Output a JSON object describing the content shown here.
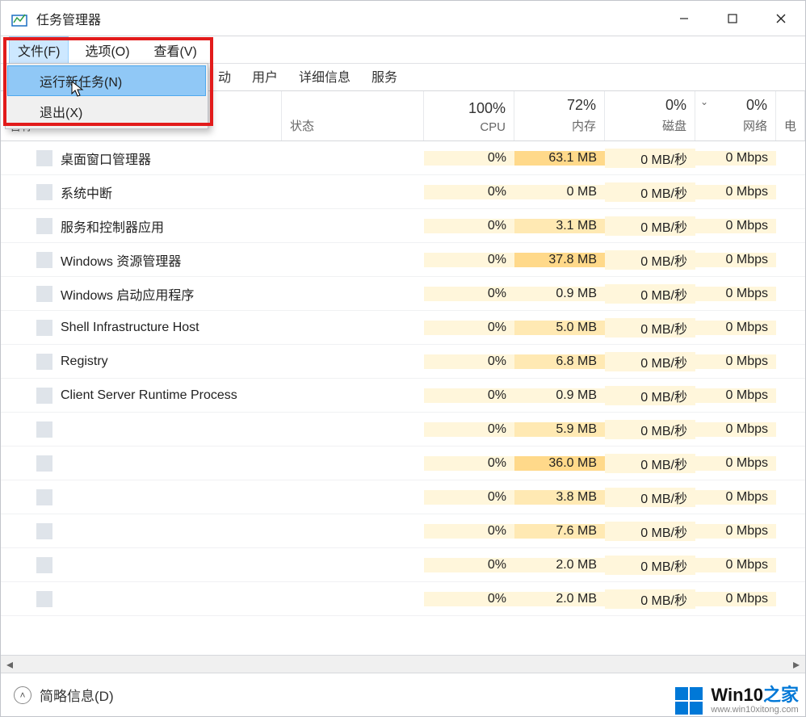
{
  "window": {
    "title": "任务管理器"
  },
  "menubar": {
    "file": "文件(F)",
    "options": "选项(O)",
    "view": "查看(V)"
  },
  "file_menu": {
    "run_new_task": "运行新任务(N)",
    "exit": "退出(X)"
  },
  "tabs": {
    "startup_suffix": "动",
    "users": "用户",
    "details": "详细信息",
    "services": "服务"
  },
  "columns": {
    "name": "名称",
    "status": "状态",
    "cpu_pct": "100%",
    "cpu_label": "CPU",
    "mem_pct": "72%",
    "mem_label": "内存",
    "disk_pct": "0%",
    "disk_label": "磁盘",
    "net_pct": "0%",
    "net_label": "网络",
    "power_label": "电"
  },
  "processes": [
    {
      "name": "桌面窗口管理器",
      "cpu": "0%",
      "mem": "63.1 MB",
      "mem_lvl": "high",
      "disk": "0 MB/秒",
      "net": "0 Mbps"
    },
    {
      "name": "系统中断",
      "cpu": "0%",
      "mem": "0 MB",
      "mem_lvl": "low",
      "disk": "0 MB/秒",
      "net": "0 Mbps"
    },
    {
      "name": "服务和控制器应用",
      "cpu": "0%",
      "mem": "3.1 MB",
      "mem_lvl": "mid",
      "disk": "0 MB/秒",
      "net": "0 Mbps"
    },
    {
      "name": "Windows 资源管理器",
      "cpu": "0%",
      "mem": "37.8 MB",
      "mem_lvl": "high",
      "disk": "0 MB/秒",
      "net": "0 Mbps"
    },
    {
      "name": "Windows 启动应用程序",
      "cpu": "0%",
      "mem": "0.9 MB",
      "mem_lvl": "low",
      "disk": "0 MB/秒",
      "net": "0 Mbps"
    },
    {
      "name": "Shell Infrastructure Host",
      "cpu": "0%",
      "mem": "5.0 MB",
      "mem_lvl": "mid",
      "disk": "0 MB/秒",
      "net": "0 Mbps"
    },
    {
      "name": "Registry",
      "cpu": "0%",
      "mem": "6.8 MB",
      "mem_lvl": "mid",
      "disk": "0 MB/秒",
      "net": "0 Mbps"
    },
    {
      "name": "Client Server Runtime Process",
      "cpu": "0%",
      "mem": "0.9 MB",
      "mem_lvl": "low",
      "disk": "0 MB/秒",
      "net": "0 Mbps"
    },
    {
      "name": "",
      "cpu": "0%",
      "mem": "5.9 MB",
      "mem_lvl": "mid",
      "disk": "0 MB/秒",
      "net": "0 Mbps"
    },
    {
      "name": "",
      "cpu": "0%",
      "mem": "36.0 MB",
      "mem_lvl": "high",
      "disk": "0 MB/秒",
      "net": "0 Mbps"
    },
    {
      "name": "",
      "cpu": "0%",
      "mem": "3.8 MB",
      "mem_lvl": "mid",
      "disk": "0 MB/秒",
      "net": "0 Mbps"
    },
    {
      "name": "",
      "cpu": "0%",
      "mem": "7.6 MB",
      "mem_lvl": "mid",
      "disk": "0 MB/秒",
      "net": "0 Mbps"
    },
    {
      "name": "",
      "cpu": "0%",
      "mem": "2.0 MB",
      "mem_lvl": "low",
      "disk": "0 MB/秒",
      "net": "0 Mbps"
    },
    {
      "name": "",
      "cpu": "0%",
      "mem": "2.0 MB",
      "mem_lvl": "low",
      "disk": "0 MB/秒",
      "net": "0 Mbps"
    }
  ],
  "footer": {
    "less_details": "简略信息(D)"
  },
  "watermark": {
    "brand_main": "Win10",
    "brand_suffix": "之家",
    "url": "www.win10xitong.com"
  }
}
